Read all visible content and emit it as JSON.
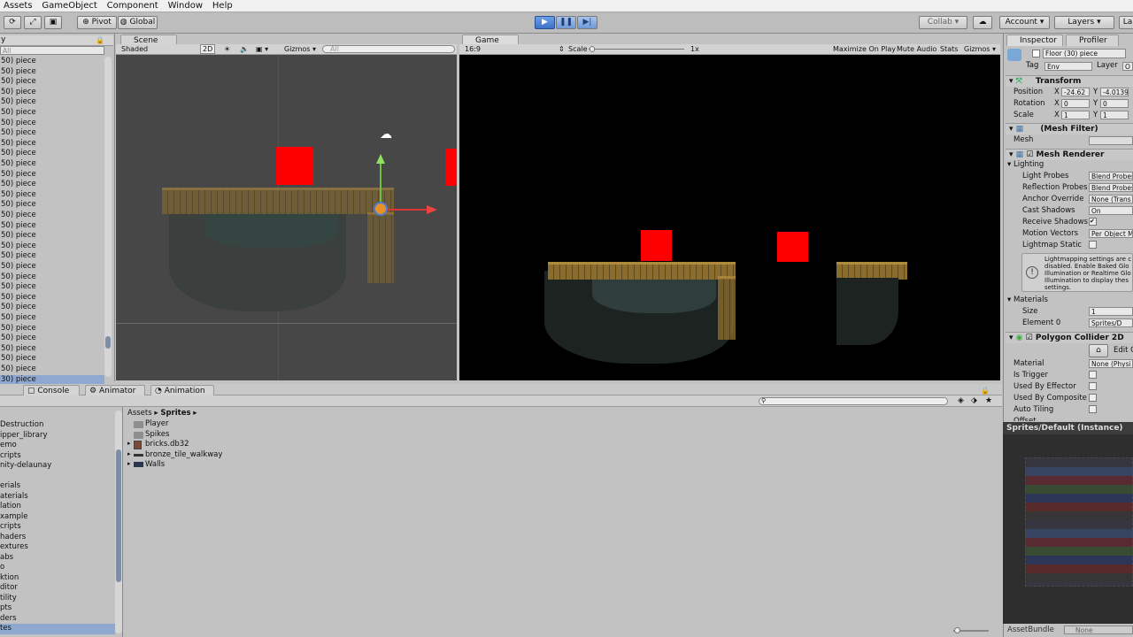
{
  "menu": [
    "Assets",
    "GameObject",
    "Component",
    "Window",
    "Help"
  ],
  "toolbar": {
    "pivot": "Pivot",
    "global": "Global",
    "collab": "Collab ▾",
    "account": "Account",
    "layers": "Layers",
    "layout": "La"
  },
  "scene": {
    "tab": "Scene",
    "shading": "Shaded",
    "mode2d": "2D",
    "gizmos": "Gizmos ▾",
    "search_placeholder": "All"
  },
  "game": {
    "tab": "Game",
    "aspect": "16:9",
    "scale_label": "Scale",
    "scale_value": "1x",
    "maximize": "Maximize On Play",
    "mute": "Mute Audio",
    "stats": "Stats",
    "gizmos": "Gizmos ▾"
  },
  "hierarchy": {
    "search_placeholder": "All",
    "items": [
      "30) piece",
      "30) piece",
      "30) piece",
      "30) piece",
      "30) piece",
      "30) piece",
      "30) piece",
      "30) piece",
      "30) piece",
      "30) piece",
      "30) piece",
      "30) piece",
      "30) piece",
      "30) piece",
      "30) piece",
      "30) piece",
      "30) piece",
      "30) piece",
      "30) piece",
      "30) piece",
      "30) piece",
      "30) piece",
      "30) piece",
      "30) piece",
      "30) piece",
      "30) piece",
      "30) piece",
      "30) piece",
      "30) piece",
      "30) piece",
      "30) piece",
      "30) piece",
      "30) piece",
      "30) piece",
      "30) piece",
      "30) piece",
      "30) piece",
      "30) piece",
      "30) piece",
      "30) piece",
      "30) piece",
      "30) piece",
      "30) piece",
      "30) piece",
      "30) piece",
      "30) piece",
      "30) piece",
      "30) piece",
      "30) piece",
      "30) piece",
      "30) piece",
      "30) piece",
      "30) piece",
      "30) piece",
      "30) piece",
      "30) piece",
      "30) piece",
      "30) piece",
      "30) piece",
      "30) piece",
      "30) piece",
      "30) piece",
      "30) piece",
      "30) piece",
      "30) piece",
      "30) piece",
      "30) piece",
      "30) piece",
      "30) piece",
      "30) piece",
      "30) piece",
      "30) piece",
      "30) piece",
      "30) piece",
      "30) piece",
      "30) piece"
    ],
    "rows": [
      "50) piece",
      "50) piece",
      "50) piece",
      "50) piece",
      "50) piece",
      "50) piece",
      "50) piece",
      "50) piece",
      "50) piece",
      "50) piece",
      "50) piece",
      "50) piece",
      "50) piece",
      "50) piece",
      "50) piece",
      "50) piece",
      "50) piece",
      "50) piece",
      "50) piece",
      "50) piece",
      "50) piece",
      "50) piece",
      "50) piece",
      "50) piece",
      "50) piece",
      "50) piece",
      "50) piece",
      "50) piece",
      "50) piece",
      "50) piece",
      "50) piece",
      "30) piece"
    ]
  },
  "inspector": {
    "tab": "Inspector",
    "profiler_tab": "Profiler",
    "object_name": "Floor (30) piece",
    "tag_label": "Tag",
    "tag_value": "Env",
    "layer_label": "Layer",
    "layer_value": "O",
    "transform": {
      "title": "Transform",
      "position_label": "Position",
      "rotation_label": "Rotation",
      "scale_label": "Scale",
      "pos_x": "-24.62",
      "pos_y": "-4.0139",
      "rot_x": "0",
      "rot_y": "0",
      "scale_x": "1",
      "scale_y": "1",
      "x": "X",
      "y": "Y"
    },
    "mesh_filter": {
      "title": "(Mesh Filter)",
      "mesh_label": "Mesh"
    },
    "mesh_renderer": {
      "title": "Mesh Renderer",
      "lighting": "Lighting",
      "light_probes": "Light Probes",
      "light_probes_value": "Blend Probes",
      "reflection_probes": "Reflection Probes",
      "reflection_probes_value": "Blend Probes",
      "anchor_override": "Anchor Override",
      "anchor_override_value": "None (Trans",
      "cast_shadows": "Cast Shadows",
      "cast_shadows_value": "On",
      "receive_shadows": "Receive Shadows",
      "motion_vectors": "Motion Vectors",
      "motion_vectors_value": "Per Object M",
      "lightmap_static": "Lightmap Static",
      "info": "Lightmapping settings are c disabled. Enable Baked Glo Illumination or Realtime Glo Illumination to display thes settings.",
      "materials": "Materials",
      "size_label": "Size",
      "size_value": "1",
      "element0_label": "Element 0",
      "element0_value": "Sprites/D"
    },
    "polygon_collider": {
      "title": "Polygon Collider 2D",
      "edit": "Edit C",
      "material": "Material",
      "material_value": "None (Physi",
      "is_trigger": "Is Trigger",
      "used_by_effector": "Used By Effector",
      "used_by_composite": "Used By Composite",
      "auto_tiling": "Auto Tiling",
      "offset": "Offset"
    },
    "preview_title": "Sprites/Default (Instance)",
    "assetbundle_label": "AssetBundle",
    "assetbundle_value": "None"
  },
  "bottom_tabs": {
    "console": "Console",
    "animator": "Animator",
    "animation": "Animation"
  },
  "project": {
    "folders": [
      "Destruction",
      "ipper_library",
      "emo",
      "cripts",
      "nity-delaunay",
      "",
      "erials",
      "aterials",
      "lation",
      "xample",
      "cripts",
      "haders",
      "extures",
      "abs",
      "o",
      "ktion",
      "ditor",
      "tility",
      "pts",
      "ders",
      "tes"
    ],
    "breadcrumb_root": "Assets",
    "breadcrumb_current": "Sprites",
    "assets": [
      "Player",
      "Spikes",
      "bricks.db32",
      "bronze_tile_walkway",
      "Walls"
    ]
  },
  "colors": {
    "accent_play": "#3d72c8",
    "game_bg": "#000000",
    "block": "#ff0000"
  }
}
